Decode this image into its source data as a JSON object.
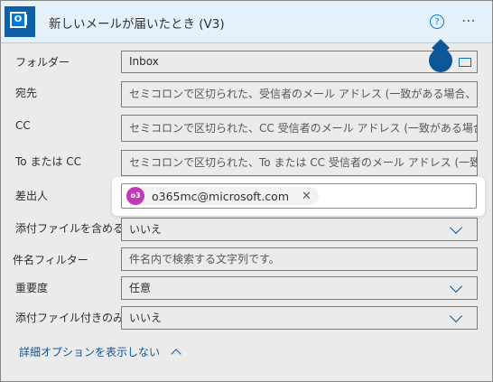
{
  "header": {
    "title": "新しいメールが届いたとき (V3)",
    "help_glyph": "?",
    "more_glyph": "⋯"
  },
  "fields": {
    "folder": {
      "label": "フォルダー",
      "value": "Inbox"
    },
    "to": {
      "label": "宛先",
      "placeholder": "セミコロンで区切られた、受信者のメール アドレス (一致がある場合、トリガーが起動します)"
    },
    "cc": {
      "label": "CC",
      "placeholder": "セミコロンで区切られた、CC 受信者のメール アドレス (一致がある場合、トリガーが起動します)"
    },
    "to_or_cc": {
      "label": "To または CC",
      "placeholder": "セミコロンで区切られた、To または CC 受信者のメール アドレス (一致がある場合)"
    },
    "from": {
      "label": "差出人",
      "token_avatar": "o3",
      "token_text": "o365mc@microsoft.com",
      "token_remove": "✕"
    },
    "include_attachments": {
      "label": "添付ファイルを含める",
      "value": "いいえ"
    },
    "subject_filter": {
      "label": "件名フィルター",
      "placeholder": "件名内で検索する文字列です。"
    },
    "importance": {
      "label": "重要度",
      "value": "任意"
    },
    "only_with_attachments": {
      "label": "添付ファイル付きのみ",
      "value": "いいえ"
    }
  },
  "advanced_toggle": "詳細オプションを表示しない",
  "colors": {
    "accent": "#0f5fa6",
    "header_bg": "#e5f1fa",
    "avatar": "#c239b3"
  }
}
